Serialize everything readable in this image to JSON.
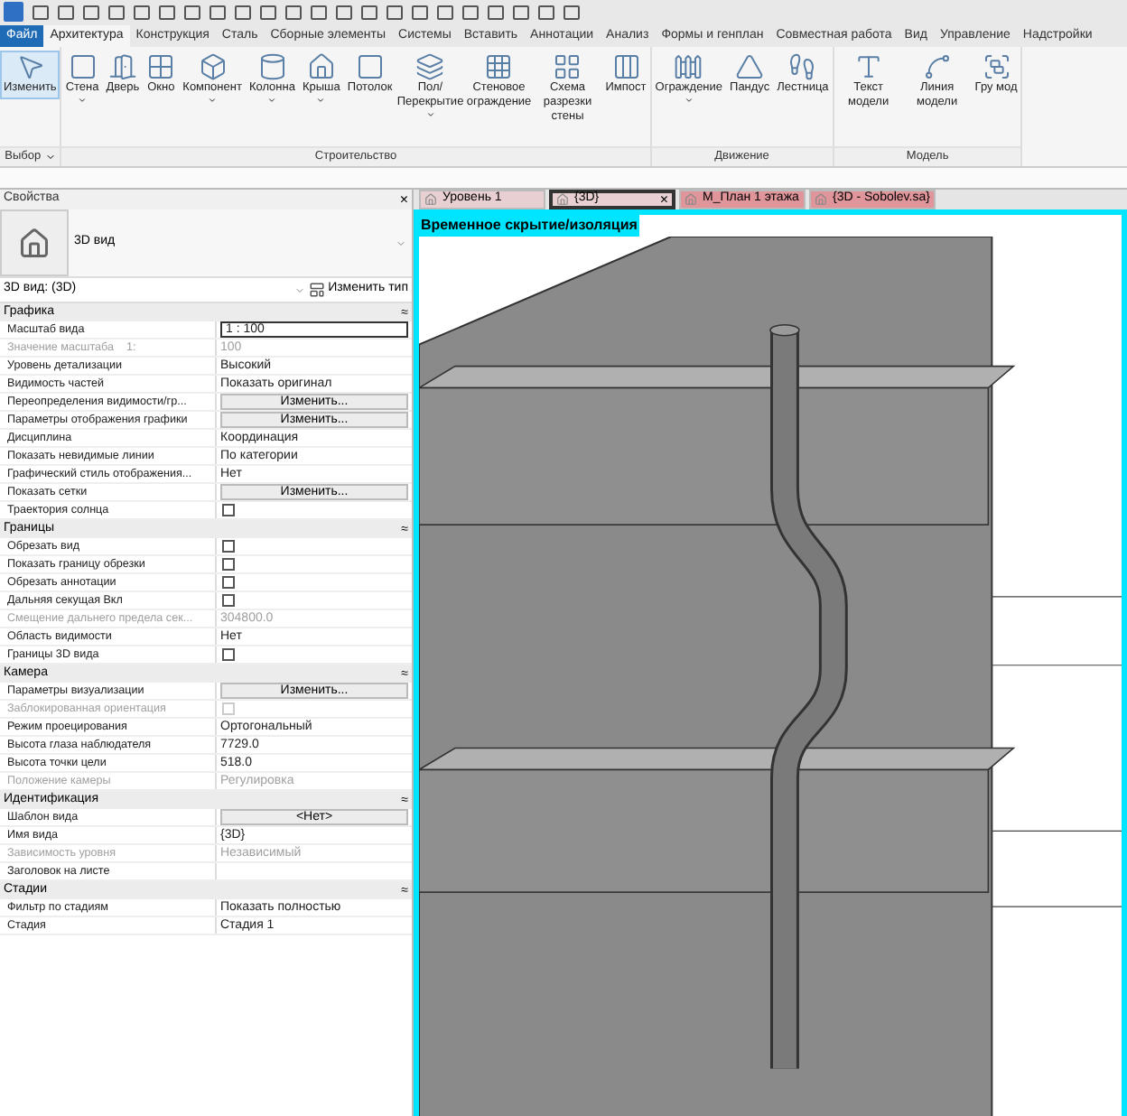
{
  "menu_tabs": [
    {
      "label": "Файл",
      "selected": false,
      "kind": "file"
    },
    {
      "label": "Архитектура",
      "selected": true,
      "kind": "tab"
    },
    {
      "label": "Конструкция",
      "selected": false,
      "kind": "tab"
    },
    {
      "label": "Сталь",
      "selected": false,
      "kind": "tab"
    },
    {
      "label": "Сборные элементы",
      "selected": false,
      "kind": "tab"
    },
    {
      "label": "Системы",
      "selected": false,
      "kind": "tab"
    },
    {
      "label": "Вставить",
      "selected": false,
      "kind": "tab"
    },
    {
      "label": "Аннотации",
      "selected": false,
      "kind": "tab"
    },
    {
      "label": "Анализ",
      "selected": false,
      "kind": "tab"
    },
    {
      "label": "Формы и генплан",
      "selected": false,
      "kind": "tab"
    },
    {
      "label": "Совместная работа",
      "selected": false,
      "kind": "tab"
    },
    {
      "label": "Вид",
      "selected": false,
      "kind": "tab"
    },
    {
      "label": "Управление",
      "selected": false,
      "kind": "tab"
    },
    {
      "label": "Надстройки",
      "selected": false,
      "kind": "tab"
    }
  ],
  "ribbon_groups": [
    {
      "title": "Выбор",
      "dropdown": true,
      "tools": [
        {
          "label": "Изменить",
          "selected": true,
          "dropdown": false
        }
      ]
    },
    {
      "title": "Строительство",
      "dropdown": false,
      "tools": [
        {
          "label": "Стена",
          "selected": false,
          "dropdown": true
        },
        {
          "label": "Дверь",
          "selected": false,
          "dropdown": false
        },
        {
          "label": "Окно",
          "selected": false,
          "dropdown": false
        },
        {
          "label": "Компонент",
          "selected": false,
          "dropdown": true
        },
        {
          "label": "Колонна",
          "selected": false,
          "dropdown": true
        },
        {
          "label": "Крыша",
          "selected": false,
          "dropdown": true
        },
        {
          "label": "Потолок",
          "selected": false,
          "dropdown": false
        },
        {
          "label": "Пол/Перекрытие",
          "selected": false,
          "dropdown": true
        },
        {
          "label": "Стеновое ограждение",
          "selected": false,
          "dropdown": false
        },
        {
          "label": "Схема разрезки стены",
          "selected": false,
          "dropdown": false
        },
        {
          "label": "Импост",
          "selected": false,
          "dropdown": false
        }
      ]
    },
    {
      "title": "Движение",
      "dropdown": false,
      "tools": [
        {
          "label": "Ограждение",
          "selected": false,
          "dropdown": true
        },
        {
          "label": "Пандус",
          "selected": false,
          "dropdown": false
        },
        {
          "label": "Лестница",
          "selected": false,
          "dropdown": false
        }
      ]
    },
    {
      "title": "Модель",
      "dropdown": false,
      "tools": [
        {
          "label": "Текст модели",
          "selected": false,
          "dropdown": false
        },
        {
          "label": "Линия модели",
          "selected": false,
          "dropdown": false
        },
        {
          "label": "Гру мод",
          "selected": false,
          "dropdown": false
        }
      ]
    }
  ],
  "properties": {
    "title": "Свойства",
    "close": "×",
    "type_name": "3D вид",
    "instance": "3D вид: (3D)",
    "edit_type": "Изменить тип",
    "sections": [
      {
        "title": "Графика",
        "collapse": "≈",
        "rows": [
          {
            "label": "Масштаб вида",
            "kind": "input",
            "value": "1 : 100",
            "disabled": false
          },
          {
            "label": "Значение масштаба    1:",
            "kind": "text",
            "value": "100",
            "disabled": true
          },
          {
            "label": "Уровень детализации",
            "kind": "text",
            "value": "Высокий",
            "disabled": false
          },
          {
            "label": "Видимость частей",
            "kind": "text",
            "value": "Показать оригинал",
            "disabled": false
          },
          {
            "label": "Переопределения видимости/гр...",
            "kind": "button",
            "value": "Изменить...",
            "disabled": false
          },
          {
            "label": "Параметры отображения графики",
            "kind": "button",
            "value": "Изменить...",
            "disabled": false
          },
          {
            "label": "Дисциплина",
            "kind": "text",
            "value": "Координация",
            "disabled": false
          },
          {
            "label": "Показать невидимые линии",
            "kind": "text",
            "value": "По категории",
            "disabled": false
          },
          {
            "label": "Графический стиль отображения...",
            "kind": "text",
            "value": "Нет",
            "disabled": false
          },
          {
            "label": "Показать сетки",
            "kind": "button",
            "value": "Изменить...",
            "disabled": false
          },
          {
            "label": "Траектория солнца",
            "kind": "checkbox",
            "checked": false,
            "disabled": false
          }
        ]
      },
      {
        "title": "Границы",
        "collapse": "≈",
        "rows": [
          {
            "label": "Обрезать вид",
            "kind": "checkbox",
            "checked": false,
            "disabled": false
          },
          {
            "label": "Показать границу обрезки",
            "kind": "checkbox",
            "checked": false,
            "disabled": false
          },
          {
            "label": "Обрезать аннотации",
            "kind": "checkbox",
            "checked": false,
            "disabled": false
          },
          {
            "label": "Дальняя секущая Вкл",
            "kind": "checkbox",
            "checked": false,
            "disabled": false
          },
          {
            "label": "Смещение дальнего предела сек...",
            "kind": "text",
            "value": "304800.0",
            "disabled": true
          },
          {
            "label": "Область видимости",
            "kind": "text",
            "value": "Нет",
            "disabled": false
          },
          {
            "label": "Границы 3D вида",
            "kind": "checkbox",
            "checked": false,
            "disabled": false
          }
        ]
      },
      {
        "title": "Камера",
        "collapse": "≈",
        "rows": [
          {
            "label": "Параметры визуализации",
            "kind": "button",
            "value": "Изменить...",
            "disabled": false
          },
          {
            "label": "Заблокированная ориентация",
            "kind": "checkbox",
            "checked": false,
            "disabled": true
          },
          {
            "label": "Режим проецирования",
            "kind": "text",
            "value": "Ортогональный",
            "disabled": false
          },
          {
            "label": "Высота глаза наблюдателя",
            "kind": "text",
            "value": "7729.0",
            "disabled": false
          },
          {
            "label": "Высота точки цели",
            "kind": "text",
            "value": "518.0",
            "disabled": false
          },
          {
            "label": "Положение камеры",
            "kind": "text",
            "value": "Регулировка",
            "disabled": true
          }
        ]
      },
      {
        "title": "Идентификация",
        "collapse": "≈",
        "rows": [
          {
            "label": "Шаблон вида",
            "kind": "button",
            "value": "<Нет>",
            "disabled": false
          },
          {
            "label": "Имя вида",
            "kind": "text",
            "value": "{3D}",
            "disabled": false
          },
          {
            "label": "Зависимость уровня",
            "kind": "text",
            "value": "Независимый",
            "disabled": true
          },
          {
            "label": "Заголовок на листе",
            "kind": "text",
            "disabled": false
          }
        ]
      },
      {
        "title": "Стадии",
        "collapse": "≈",
        "rows": [
          {
            "label": "Фильтр по стадиям",
            "kind": "text",
            "value": "Показать полностью",
            "disabled": false
          },
          {
            "label": "Стадия",
            "kind": "text",
            "value": "Стадия 1",
            "disabled": false
          }
        ]
      }
    ]
  },
  "view_tabs": {
    "close": "×",
    "tabs": [
      {
        "label": "Уровень 1",
        "selected": false,
        "color": "#e8cfd2",
        "closable": false
      },
      {
        "label": "{3D}",
        "selected": true,
        "color": "#e8cfd2",
        "closable": true
      },
      {
        "label": "M_План 1 этажа",
        "selected": false,
        "color": "#e0959a",
        "closable": false
      },
      {
        "label": "{3D - Sobolev.sa}",
        "selected": false,
        "color": "#e0959a",
        "closable": false
      }
    ]
  },
  "viewport": {
    "isolation_label": "Временное скрытие/изоляция",
    "isolation_on": true
  }
}
